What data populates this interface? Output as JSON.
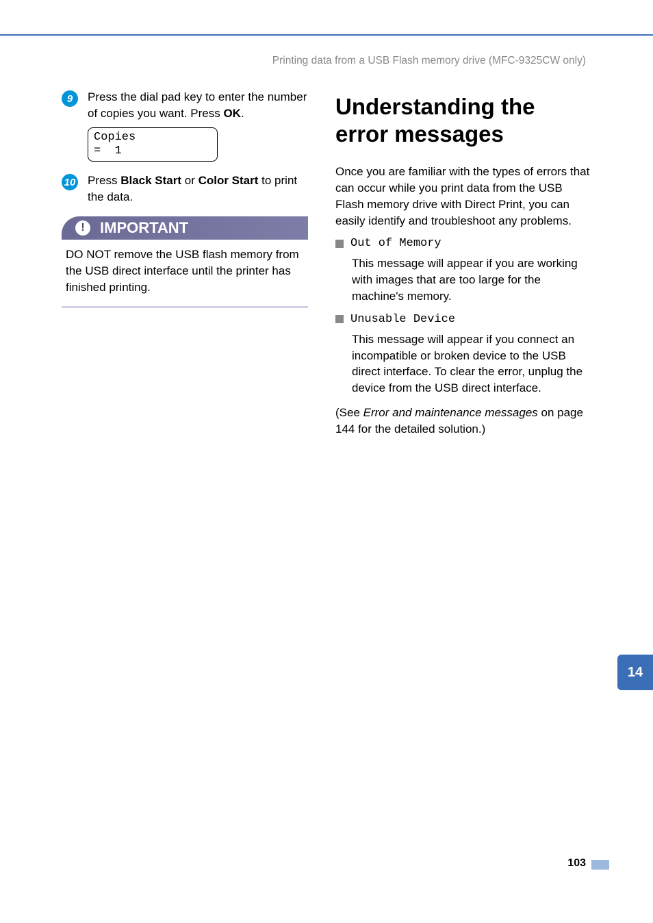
{
  "header": {
    "breadcrumb": "Printing data from a USB Flash memory drive (MFC-9325CW only)"
  },
  "left": {
    "step9": {
      "num": "9",
      "text_pre": "Press the dial pad key to enter the number of copies you want. Press ",
      "bold1": "OK",
      "text_post": ".",
      "lcd": "Copies\n=  1"
    },
    "step10": {
      "num": "10",
      "text_pre": "Press ",
      "bold1": "Black Start",
      "mid1": " or ",
      "bold2": "Color Start",
      "text_post": " to print the data."
    },
    "important": {
      "title": "IMPORTANT",
      "body": "DO NOT remove the USB flash memory from the USB direct interface until the printer has finished printing."
    }
  },
  "right": {
    "heading": "Understanding the error messages",
    "intro": "Once you are familiar with the types of errors that can occur while you print data from the USB Flash memory drive with Direct Print, you can easily identify and troubleshoot any problems.",
    "errors": [
      {
        "label": "Out of Memory",
        "desc": "This message will appear if you are working with images that are too large for the machine's memory."
      },
      {
        "label": "Unusable Device",
        "desc": "This message will appear if you connect an incompatible or broken device to the USB direct interface. To clear the error, unplug the device from the USB direct interface."
      }
    ],
    "see_pre": "(See ",
    "see_link": "Error and maintenance messages",
    "see_post": " on page 144 for the detailed solution.)"
  },
  "side_tab": "14",
  "page_number": "103"
}
